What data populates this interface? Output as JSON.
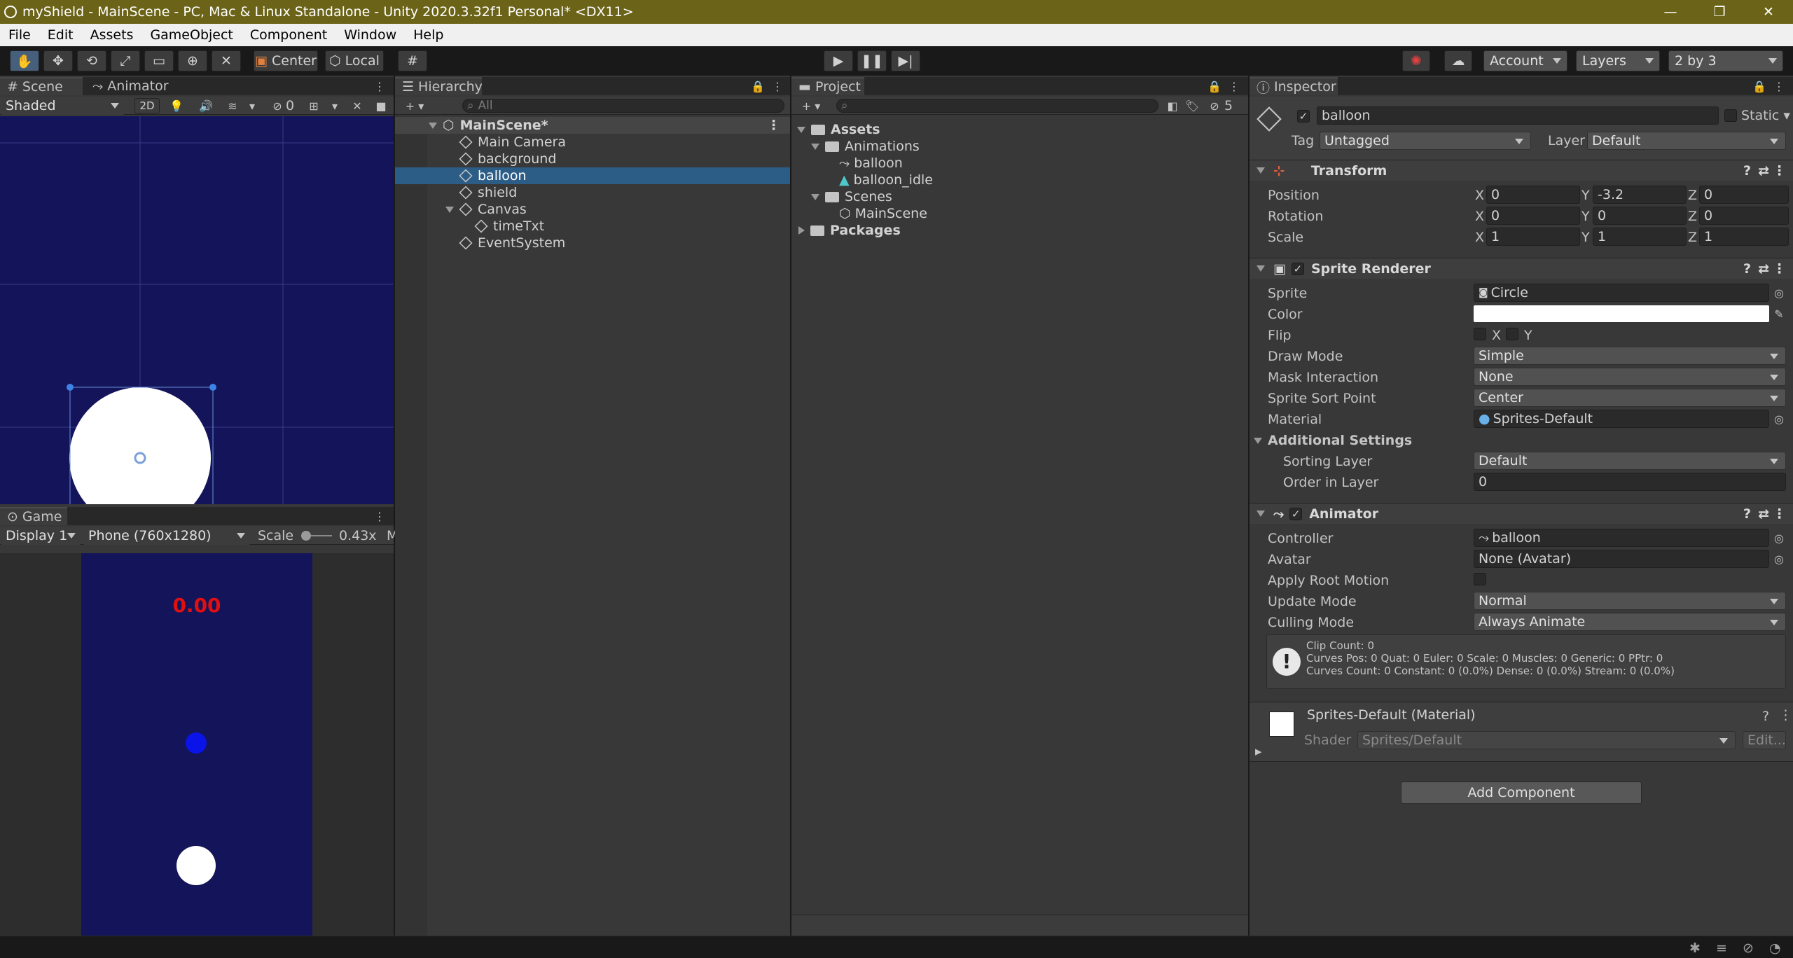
{
  "window": {
    "title": "myShield - MainScene - PC, Mac & Linux Standalone - Unity 2020.3.32f1 Personal* <DX11>"
  },
  "menu": [
    "File",
    "Edit",
    "Assets",
    "GameObject",
    "Component",
    "Window",
    "Help"
  ],
  "toolbar": {
    "pivot_label": "Center",
    "space_label": "Local",
    "account_label": "Account",
    "layers_label": "Layers",
    "layout_label": "2 by 3"
  },
  "scene": {
    "tab_scene": "Scene",
    "tab_animator": "Animator",
    "shading": "Shaded",
    "mode_2d": "2D",
    "hidden_count": "0"
  },
  "game": {
    "tab": "Game",
    "display": "Display 1",
    "resolution": "Phone (760x1280)",
    "scale_label": "Scale",
    "scale_value": "0.43x",
    "scale_value_fraction": 0.0,
    "maximize_label": "M",
    "timer": "0.00",
    "colors": {
      "background": "#14145a",
      "timer": "#e01010",
      "shield": "#0a14e8",
      "balloon": "#ffffff"
    }
  },
  "hierarchy": {
    "tab": "Hierarchy",
    "search_placeholder": "All",
    "scene_name": "MainScene*",
    "items": [
      {
        "label": "Main Camera"
      },
      {
        "label": "background"
      },
      {
        "label": "balloon"
      },
      {
        "label": "shield"
      },
      {
        "label": "Canvas"
      },
      {
        "label": "timeTxt"
      },
      {
        "label": "EventSystem"
      }
    ]
  },
  "project": {
    "tab": "Project",
    "hidden_count": "5",
    "tree": [
      {
        "label": "Assets"
      },
      {
        "label": "Animations"
      },
      {
        "label": "balloon"
      },
      {
        "label": "balloon_idle"
      },
      {
        "label": "Scenes"
      },
      {
        "label": "MainScene"
      },
      {
        "label": "Packages"
      }
    ]
  },
  "inspector": {
    "tab": "Inspector",
    "object_name": "balloon",
    "static_label": "Static",
    "tag_label": "Tag",
    "tag_value": "Untagged",
    "layer_label": "Layer",
    "layer_value": "Default",
    "transform": {
      "title": "Transform",
      "rows": [
        {
          "label": "Position",
          "x": "0",
          "y": "-3.2",
          "z": "0"
        },
        {
          "label": "Rotation",
          "x": "0",
          "y": "0",
          "z": "0"
        },
        {
          "label": "Scale",
          "x": "1",
          "y": "1",
          "z": "1"
        }
      ],
      "axis_x": "X",
      "axis_y": "Y",
      "axis_z": "Z"
    },
    "sprite_renderer": {
      "title": "Sprite Renderer",
      "sprite_label": "Sprite",
      "sprite_value": "Circle",
      "color_label": "Color",
      "color_value": "#ffffff",
      "flip_label": "Flip",
      "flip_x": "X",
      "flip_y": "Y",
      "draw_mode_label": "Draw Mode",
      "draw_mode": "Simple",
      "mask_label": "Mask Interaction",
      "mask": "None",
      "sort_point_label": "Sprite Sort Point",
      "sort_point": "Center",
      "material_label": "Material",
      "material": "Sprites-Default",
      "additional_label": "Additional Settings",
      "sorting_layer_label": "Sorting Layer",
      "sorting_layer": "Default",
      "order_label": "Order in Layer",
      "order": "0"
    },
    "animator": {
      "title": "Animator",
      "controller_label": "Controller",
      "controller": "balloon",
      "avatar_label": "Avatar",
      "avatar": "None (Avatar)",
      "root_motion_label": "Apply Root Motion",
      "update_label": "Update Mode",
      "update": "Normal",
      "culling_label": "Culling Mode",
      "culling": "Always Animate",
      "info_line1": "Clip Count: 0",
      "info_line2": "Curves Pos: 0 Quat: 0 Euler: 0 Scale: 0 Muscles: 0 Generic: 0 PPtr: 0",
      "info_line3": "Curves Count: 0 Constant: 0 (0.0%) Dense: 0 (0.0%) Stream: 0 (0.0%)"
    },
    "material": {
      "title": "Sprites-Default (Material)",
      "shader_label": "Shader",
      "shader": "Sprites/Default",
      "edit_label": "Edit..."
    },
    "add_component": "Add Component"
  }
}
